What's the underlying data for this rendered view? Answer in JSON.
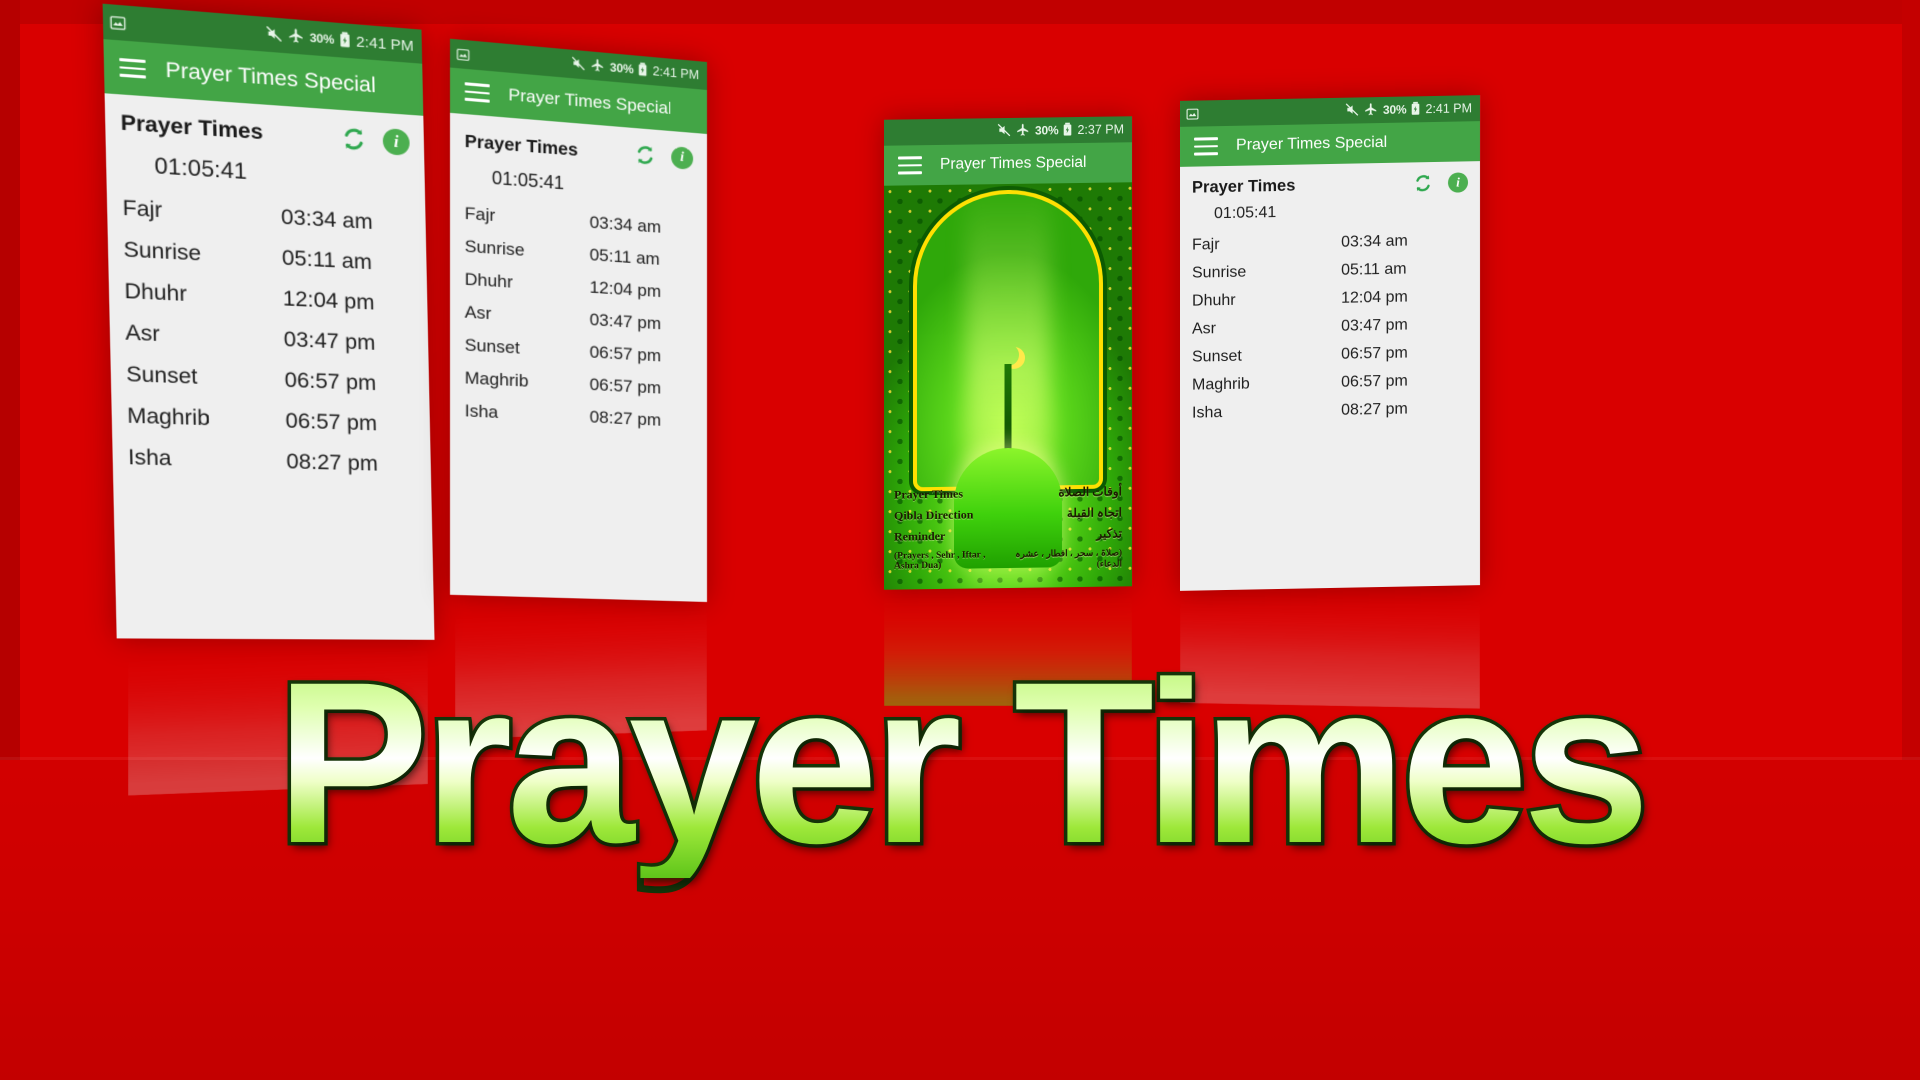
{
  "background": {
    "color": "#D90000",
    "accent_green": "#43A546",
    "status_green": "#2E7D32"
  },
  "hero": {
    "title": "Prayer Times"
  },
  "status_bar": {
    "mute_icon": "mute-icon",
    "airplane_icon": "airplane-mode-icon",
    "battery_percent": "30%",
    "battery_icon": "battery-charging-icon",
    "screenshot_icon": "screenshot-icon"
  },
  "app_bar": {
    "menu_icon": "hamburger-menu-icon",
    "title": "Prayer Times Special"
  },
  "prayer_screen": {
    "section_title": "Prayer Times",
    "refresh_icon": "refresh-icon",
    "info_icon": "info-icon",
    "info_label": "i",
    "countdown": "01:05:41",
    "rows": [
      {
        "name": "Fajr",
        "time": "03:34 am"
      },
      {
        "name": "Sunrise",
        "time": "05:11 am"
      },
      {
        "name": "Dhuhr",
        "time": "12:04 pm"
      },
      {
        "name": "Asr",
        "time": "03:47 pm"
      },
      {
        "name": "Sunset",
        "time": "06:57 pm"
      },
      {
        "name": "Maghrib",
        "time": "06:57 pm"
      },
      {
        "name": "Isha",
        "time": "08:27 pm"
      }
    ]
  },
  "phones": [
    {
      "id": "phone1",
      "time": "2:41 PM",
      "screen": "prayer-times"
    },
    {
      "id": "phone2",
      "time": "2:41 PM",
      "screen": "prayer-times"
    },
    {
      "id": "phone3",
      "time": "2:37 PM",
      "screen": "splash-menu"
    },
    {
      "id": "phone4",
      "time": "2:41 PM",
      "screen": "prayer-times"
    }
  ],
  "splash": {
    "menu": [
      {
        "en": "Prayer Times",
        "ur": "أوقات الصلاة"
      },
      {
        "en": "Qibla Direction",
        "ur": "اتجاہ القبلة"
      },
      {
        "en": "Reminder",
        "ur": "تذکیر"
      }
    ],
    "footnote": {
      "en": "(Prayers , Sehr ,  Iftar , Ashra Dua)",
      "ur": "(صلاۃ ، سحر ، افطار ، عشرہ الدعاء)"
    },
    "mosque_icon": "mosque-dome-icon",
    "crescent_icon": "crescent-moon-icon"
  }
}
